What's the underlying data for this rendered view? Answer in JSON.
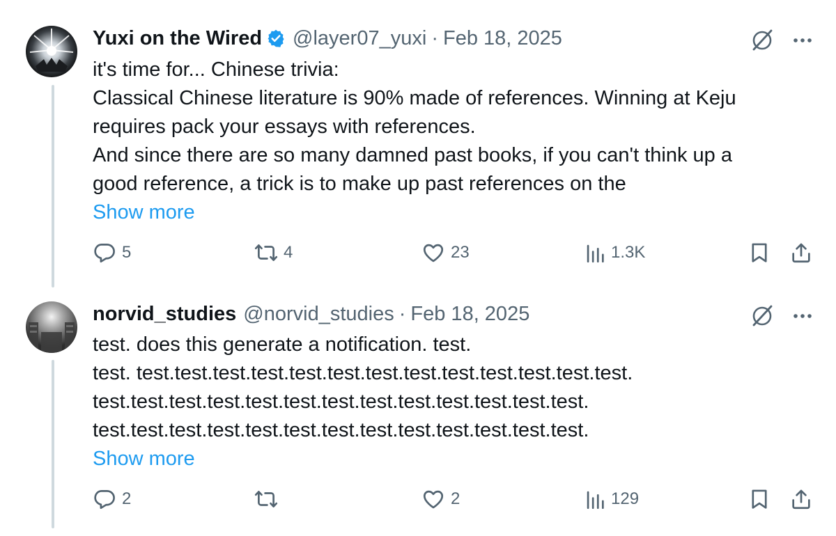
{
  "tweets": [
    {
      "author_name": "Yuxi on the Wired",
      "verified": true,
      "handle": "@layer07_yuxi",
      "separator": "·",
      "date": "Feb 18, 2025",
      "lines": [
        "it's time for... Chinese trivia:",
        "Classical Chinese literature is 90% made of references. Winning at Keju",
        "requires pack your essays with references.",
        "And since there are so many damned past books, if you can't think up a",
        "good reference, a trick is to make up past references on the"
      ],
      "show_more": "Show more",
      "stats": {
        "replies": "5",
        "reposts": "4",
        "likes": "23",
        "views": "1.3K"
      }
    },
    {
      "author_name": "norvid_studies",
      "verified": false,
      "handle": "@norvid_studies",
      "separator": "·",
      "date": "Feb 18, 2025",
      "lines": [
        "test. does this generate a notification. test.",
        "test. test.test.test.test.test.test.test.test.test.test.test.test.test.",
        "test.test.test.test.test.test.test.test.test.test.test.test.test.",
        "test.test.test.test.test.test.test.test.test.test.test.test.test."
      ],
      "show_more": "Show more",
      "stats": {
        "replies": "2",
        "reposts": "",
        "likes": "2",
        "views": "129"
      }
    }
  ],
  "colors": {
    "text": "#0f1419",
    "secondary": "#536471",
    "link": "#1d9bf0",
    "verified_badge": "#1d9bf0",
    "thread_line": "#cfd9de"
  },
  "icons": [
    "grok-icon",
    "more-icon",
    "reply-icon",
    "repost-icon",
    "like-icon",
    "views-icon",
    "bookmark-icon",
    "share-icon",
    "verified-badge-icon"
  ]
}
